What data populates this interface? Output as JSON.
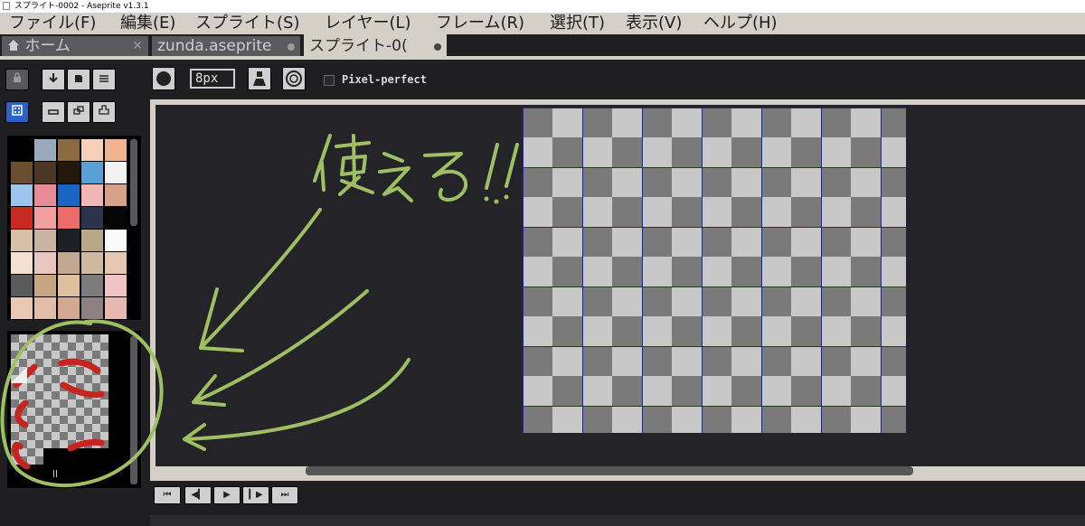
{
  "window": {
    "title": "スプライト-0002 - Aseprite v1.3.1"
  },
  "menu": {
    "file": "ファイル(F)",
    "edit": "編集(E)",
    "sprite": "スプライト(S)",
    "layer": "レイヤー(L)",
    "frame": "フレーム(R)",
    "select": "選択(T)",
    "view": "表示(V)",
    "help": "ヘルプ(H)"
  },
  "tabs": {
    "home": "ホーム",
    "file1": "zunda.aseprite",
    "file2": "スプライト-0("
  },
  "toolbar": {
    "brush_size": "8px",
    "pixel_perfect_label": "Pixel-perfect",
    "pixel_perfect_checked": false
  },
  "tileset": {
    "label": "ll"
  },
  "annotation": {
    "handwritten_text": "使える!!"
  },
  "colors": {
    "checker_light": "#c8c8c8",
    "checker_dark": "#7a7a7a",
    "grid_line": "#1e1ec8",
    "annotation_green": "#9ebf62",
    "accent_blue": "#2b62c6"
  },
  "palette": [
    "#000000",
    "#9aaabe",
    "#8a6a3e",
    "#f6d0b8",
    "#f0b490",
    "#6a4e30",
    "#4a3824",
    "#22180e",
    "#5aa0d6",
    "#f2f2f2",
    "#9cc4ec",
    "#e88a98",
    "#1a64c4",
    "#f2b6b6",
    "#d8a088",
    "#c62a22",
    "#f2a0a0",
    "#ec6c6c",
    "#2c344c",
    "#060606",
    "#d8c0a8",
    "#c8b4a0",
    "#1c2024",
    "#b8a888",
    "#fafafa",
    "#f4e0d0",
    "#eac6c0",
    "#c2a890",
    "#d0b8a0",
    "#e6c8b0",
    "#5a5a5a",
    "#c8a684",
    "#dcc0a0",
    "#7c7c7c",
    "#f0c4c4",
    "#e8c8b4",
    "#e2bea8",
    "#d4a890",
    "#8c8080",
    "#e8b8b0"
  ]
}
